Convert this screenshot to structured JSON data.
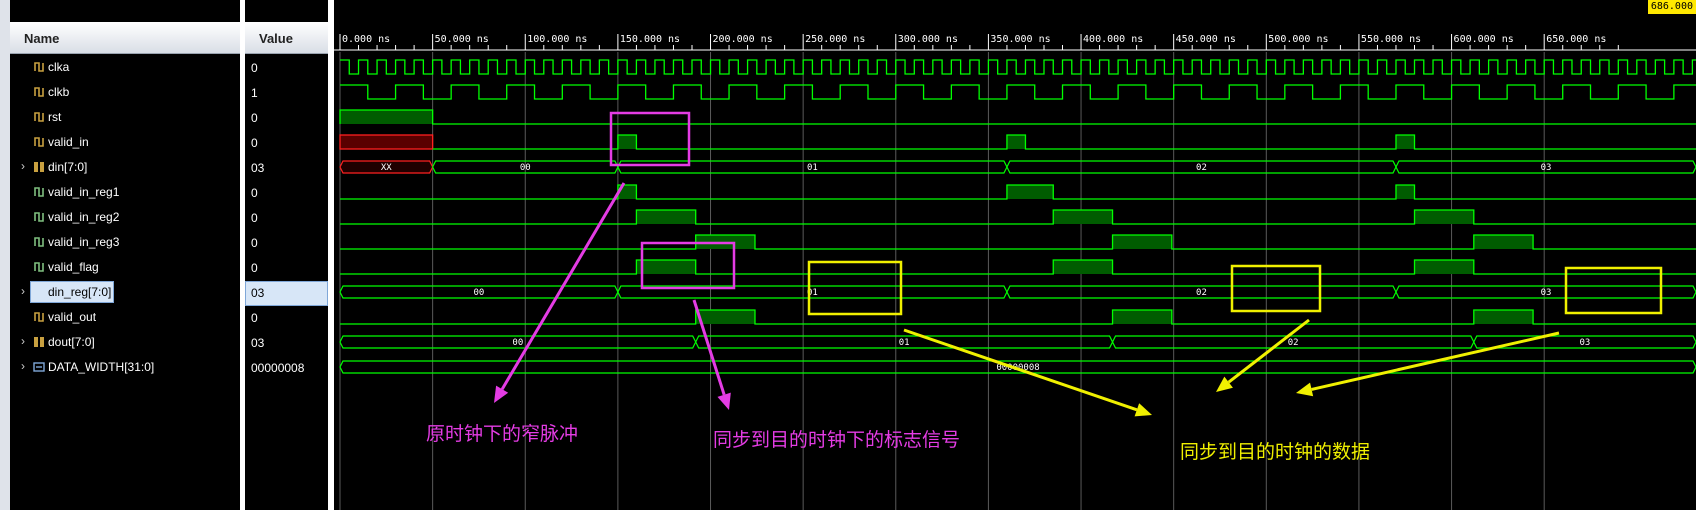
{
  "headers": {
    "name": "Name",
    "value": "Value"
  },
  "cursor_time": "686.000",
  "signals": [
    {
      "name": "clka",
      "value": "0",
      "icon": "bit-signal-icon",
      "expandable": false
    },
    {
      "name": "clkb",
      "value": "1",
      "icon": "bit-signal-icon",
      "expandable": false
    },
    {
      "name": "rst",
      "value": "0",
      "icon": "bit-signal-icon",
      "expandable": false
    },
    {
      "name": "valid_in",
      "value": "0",
      "icon": "bit-signal-icon",
      "expandable": false
    },
    {
      "name": "din[7:0]",
      "value": "03",
      "icon": "bus-signal-icon",
      "expandable": true
    },
    {
      "name": "valid_in_reg1",
      "value": "0",
      "icon": "reg-bit-icon",
      "expandable": false
    },
    {
      "name": "valid_in_reg2",
      "value": "0",
      "icon": "reg-bit-icon",
      "expandable": false
    },
    {
      "name": "valid_in_reg3",
      "value": "0",
      "icon": "reg-bit-icon",
      "expandable": false
    },
    {
      "name": "valid_flag",
      "value": "0",
      "icon": "reg-bit-icon",
      "expandable": false
    },
    {
      "name": "din_reg[7:0]",
      "value": "03",
      "icon": "reg-bus-icon",
      "expandable": true,
      "selected": true
    },
    {
      "name": "valid_out",
      "value": "0",
      "icon": "bit-signal-icon",
      "expandable": false
    },
    {
      "name": "dout[7:0]",
      "value": "03",
      "icon": "bus-signal-icon",
      "expandable": true
    },
    {
      "name": "DATA_WIDTH[31:0]",
      "value": "00000008",
      "icon": "param-icon",
      "expandable": true
    }
  ],
  "time_axis": [
    "0.000 ns",
    "50.000 ns",
    "100.000 ns",
    "150.000 ns",
    "200.000 ns",
    "250.000 ns",
    "300.000 ns",
    "350.000 ns",
    "400.000 ns",
    "450.000 ns",
    "500.000 ns",
    "550.000 ns",
    "600.000 ns",
    "650.000 ns"
  ],
  "bus_labels": {
    "din": [
      "XX",
      "00",
      "01",
      "02",
      "03"
    ],
    "din_reg": [
      "00",
      "01",
      "02",
      "03"
    ],
    "dout": [
      "00",
      "01",
      "02",
      "03"
    ],
    "data_width": "00000008"
  },
  "annotations": {
    "narrow_pulse": "原时钟下的窄脉冲",
    "sync_flag": "同步到目的时钟下的标志信号",
    "sync_data": "同步到目的时钟的数据"
  },
  "colors": {
    "wave": "#00ff00",
    "wave_fill": "#005c00",
    "undefined": "#ff2020",
    "magenta": "#e43ce4",
    "yellow": "#f0f000",
    "grid": "#5a5a5a"
  }
}
